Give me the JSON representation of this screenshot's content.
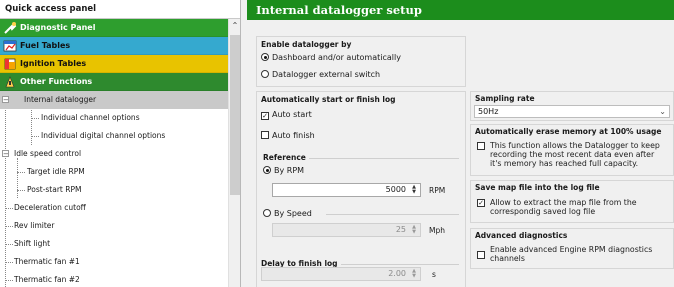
{
  "quick_access": {
    "title": "Quick access panel",
    "categories": {
      "diagnostic": "Diagnostic Panel",
      "fuel": "Fuel Tables",
      "ignition": "Ignition Tables",
      "other": "Other Functions"
    },
    "tree": {
      "internal_datalogger": "Internal datalogger",
      "individual_channel": "Individual channel options",
      "individual_digital": "Individual digital channel options",
      "idle_speed": "Idle speed control",
      "target_idle": "Target idle RPM",
      "post_start": "Post-start RPM",
      "decel_cutoff": "Deceleration cutoff",
      "rev_limiter": "Rev limiter",
      "shift_light": "Shift light",
      "fan1": "Thermatic fan #1",
      "fan2": "Thermatic fan #2"
    }
  },
  "main": {
    "title": "Internal datalogger setup",
    "enable": {
      "label": "Enable datalogger by",
      "opt1": "Dashboard and/or automatically",
      "opt2": "Datalogger external switch"
    },
    "auto": {
      "label": "Automatically start or finish log",
      "auto_start": "Auto start",
      "auto_finish": "Auto finish",
      "reference": "Reference",
      "by_rpm": "By RPM",
      "rpm_value": "5000",
      "rpm_unit": "RPM",
      "by_speed": "By Speed",
      "speed_value": "25",
      "speed_unit": "Mph",
      "delay_label": "Delay to finish log",
      "delay_value": "2.00",
      "delay_unit": "s"
    },
    "sampling": {
      "label": "Sampling rate",
      "value": "50Hz"
    },
    "erase": {
      "label": "Automatically erase memory at 100% usage",
      "line1": "This function allows the Datalogger to keep",
      "line2": "recording the most recent data even after",
      "line3": "it's memory has reached full capacity."
    },
    "mapfile": {
      "label": "Save map file into the log file",
      "line1": "Allow to extract the map file from the",
      "line2": "correspondig saved log file"
    },
    "advanced": {
      "label": "Advanced diagnostics",
      "line1": "Enable advanced Engine RPM diagnostics",
      "line2": "channels"
    }
  }
}
